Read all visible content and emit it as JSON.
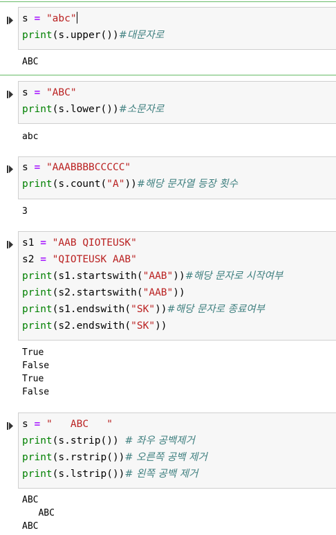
{
  "cells": [
    {
      "code": [
        [
          {
            "c": "var",
            "t": "s "
          },
          {
            "c": "op",
            "t": "="
          },
          {
            "c": "var",
            "t": " "
          },
          {
            "c": "str",
            "t": "\"abc\""
          }
        ],
        [
          {
            "c": "fn",
            "t": "print"
          },
          {
            "c": "var",
            "t": "(s.upper())"
          },
          {
            "c": "cm",
            "t": "#대문자로"
          }
        ]
      ],
      "output": [
        "ABC"
      ]
    },
    {
      "code": [
        [
          {
            "c": "var",
            "t": "s "
          },
          {
            "c": "op",
            "t": "="
          },
          {
            "c": "var",
            "t": " "
          },
          {
            "c": "str",
            "t": "\"ABC\""
          }
        ],
        [
          {
            "c": "fn",
            "t": "print"
          },
          {
            "c": "var",
            "t": "(s.lower())"
          },
          {
            "c": "cm",
            "t": "#소문자로"
          }
        ]
      ],
      "output": [
        "abc"
      ]
    },
    {
      "code": [
        [
          {
            "c": "var",
            "t": "s "
          },
          {
            "c": "op",
            "t": "="
          },
          {
            "c": "var",
            "t": " "
          },
          {
            "c": "str",
            "t": "\"AAABBBBCCCCC\""
          }
        ],
        [
          {
            "c": "fn",
            "t": "print"
          },
          {
            "c": "var",
            "t": "(s.count("
          },
          {
            "c": "str",
            "t": "\"A\""
          },
          {
            "c": "var",
            "t": "))"
          },
          {
            "c": "cm",
            "t": "#해당 문자열 등장 횟수"
          }
        ]
      ],
      "output": [
        "3"
      ]
    },
    {
      "code": [
        [
          {
            "c": "var",
            "t": "s1 "
          },
          {
            "c": "op",
            "t": "="
          },
          {
            "c": "var",
            "t": " "
          },
          {
            "c": "str",
            "t": "\"AAB QIOTEUSK\""
          }
        ],
        [
          {
            "c": "var",
            "t": "s2 "
          },
          {
            "c": "op",
            "t": "="
          },
          {
            "c": "var",
            "t": " "
          },
          {
            "c": "str",
            "t": "\"QIOTEUSK AAB\""
          }
        ],
        [
          {
            "c": "fn",
            "t": "print"
          },
          {
            "c": "var",
            "t": "(s1.startswith("
          },
          {
            "c": "str",
            "t": "\"AAB\""
          },
          {
            "c": "var",
            "t": "))"
          },
          {
            "c": "cm",
            "t": "#해당 문자로 시작여부"
          }
        ],
        [
          {
            "c": "fn",
            "t": "print"
          },
          {
            "c": "var",
            "t": "(s2.startswith("
          },
          {
            "c": "str",
            "t": "\"AAB\""
          },
          {
            "c": "var",
            "t": "))"
          }
        ],
        [
          {
            "c": "fn",
            "t": "print"
          },
          {
            "c": "var",
            "t": "(s1.endswith("
          },
          {
            "c": "str",
            "t": "\"SK\""
          },
          {
            "c": "var",
            "t": "))"
          },
          {
            "c": "cm",
            "t": "#해당 문자로 종료여부"
          }
        ],
        [
          {
            "c": "fn",
            "t": "print"
          },
          {
            "c": "var",
            "t": "(s2.endswith("
          },
          {
            "c": "str",
            "t": "\"SK\""
          },
          {
            "c": "var",
            "t": "))"
          }
        ]
      ],
      "output": [
        "True",
        "False",
        "True",
        "False"
      ]
    },
    {
      "code": [
        [
          {
            "c": "var",
            "t": "s "
          },
          {
            "c": "op",
            "t": "="
          },
          {
            "c": "var",
            "t": " "
          },
          {
            "c": "str",
            "t": "\"   ABC   \""
          }
        ],
        [
          {
            "c": "fn",
            "t": "print"
          },
          {
            "c": "var",
            "t": "(s.strip()) "
          },
          {
            "c": "cm",
            "t": "# 좌우 공백제거"
          }
        ],
        [
          {
            "c": "fn",
            "t": "print"
          },
          {
            "c": "var",
            "t": "(s.rstrip())"
          },
          {
            "c": "cm",
            "t": "# 오른쪽 공백 제거"
          }
        ],
        [
          {
            "c": "fn",
            "t": "print"
          },
          {
            "c": "var",
            "t": "(s.lstrip())"
          },
          {
            "c": "cm",
            "t": "# 왼쪽 공백 제거"
          }
        ]
      ],
      "output": [
        "ABC",
        "   ABC",
        "ABC"
      ]
    }
  ],
  "icons": {
    "run": "run-cell-icon"
  },
  "colors": {
    "keyword": "#008000",
    "string": "#ba2121",
    "operator": "#aa22ff",
    "comment": "#408080",
    "selected_border": "#66bb66"
  }
}
